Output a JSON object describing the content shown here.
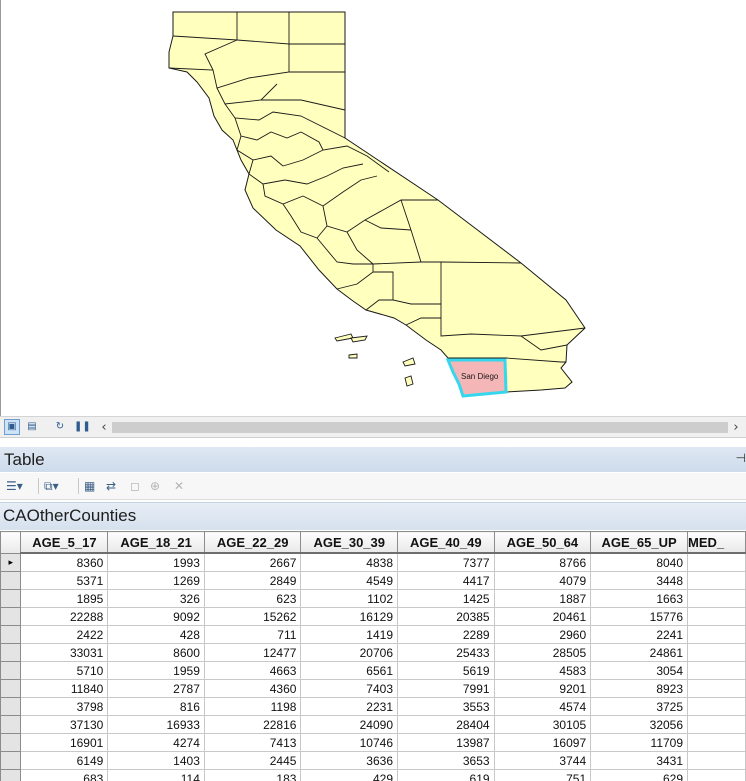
{
  "map": {
    "selected_county_label": "San Diego",
    "colors": {
      "land": "#ffffbe",
      "selected_fill": "#f4b6b6",
      "selected_outline": "#35d7ef",
      "boundary": "#1a1a1a"
    }
  },
  "map_toolbar": {
    "buttons": [
      {
        "name": "data-view-icon",
        "glyph": "▣"
      },
      {
        "name": "layout-view-icon",
        "glyph": "▤"
      },
      {
        "name": "refresh-icon",
        "glyph": "↻"
      },
      {
        "name": "pause-icon",
        "glyph": "❚❚"
      }
    ],
    "scroll_left": "‹",
    "scroll_right": "›"
  },
  "table_window": {
    "title": "Table",
    "pin": "⊣",
    "layer_tab": "CAOtherCounties",
    "toolbar": [
      {
        "name": "table-options-icon",
        "glyph": "☰▾",
        "enabled": true
      },
      {
        "name": "related-tables-icon",
        "glyph": "⧉▾",
        "enabled": true
      },
      {
        "name": "select-by-attributes-icon",
        "glyph": "▦",
        "enabled": true
      },
      {
        "name": "switch-selection-icon",
        "glyph": "⇄",
        "enabled": true
      },
      {
        "name": "clear-selection-icon",
        "glyph": "◻",
        "enabled": false
      },
      {
        "name": "zoom-to-selected-icon",
        "glyph": "⊕",
        "enabled": false
      },
      {
        "name": "delete-selected-icon",
        "glyph": "✕",
        "enabled": false
      }
    ]
  },
  "grid": {
    "columns": [
      "AGE_5_17",
      "AGE_18_21",
      "AGE_22_29",
      "AGE_30_39",
      "AGE_40_49",
      "AGE_50_64",
      "AGE_65_UP",
      "MED_"
    ],
    "current_row_marker": "▸",
    "rows": [
      [
        "8360",
        "1993",
        "2667",
        "4838",
        "7377",
        "8766",
        "8040",
        ""
      ],
      [
        "5371",
        "1269",
        "2849",
        "4549",
        "4417",
        "4079",
        "3448",
        ""
      ],
      [
        "1895",
        "326",
        "623",
        "1102",
        "1425",
        "1887",
        "1663",
        ""
      ],
      [
        "22288",
        "9092",
        "15262",
        "16129",
        "20385",
        "20461",
        "15776",
        ""
      ],
      [
        "2422",
        "428",
        "711",
        "1419",
        "2289",
        "2960",
        "2241",
        ""
      ],
      [
        "33031",
        "8600",
        "12477",
        "20706",
        "25433",
        "28505",
        "24861",
        ""
      ],
      [
        "5710",
        "1959",
        "4663",
        "6561",
        "5619",
        "4583",
        "3054",
        ""
      ],
      [
        "11840",
        "2787",
        "4360",
        "7403",
        "7991",
        "9201",
        "8923",
        ""
      ],
      [
        "3798",
        "816",
        "1198",
        "2231",
        "3553",
        "4574",
        "3725",
        ""
      ],
      [
        "37130",
        "16933",
        "22816",
        "24090",
        "28404",
        "30105",
        "32056",
        ""
      ],
      [
        "16901",
        "4274",
        "7413",
        "10746",
        "13987",
        "16097",
        "11709",
        ""
      ],
      [
        "6149",
        "1403",
        "2445",
        "3636",
        "3653",
        "3744",
        "3431",
        ""
      ],
      [
        "683",
        "114",
        "183",
        "429",
        "619",
        "751",
        "629",
        ""
      ]
    ]
  }
}
